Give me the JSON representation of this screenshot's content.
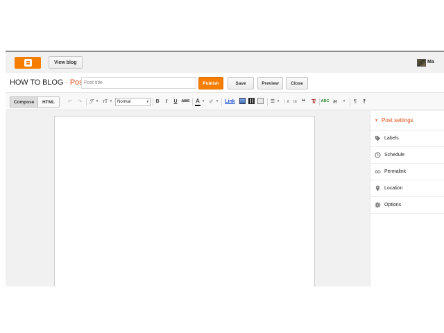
{
  "topbar": {
    "logo_icon": "blogger-icon",
    "view_blog_label": "View blog",
    "account_name": "Ma"
  },
  "titlebar": {
    "blog_name": "HOW TO BLOG",
    "separator": "·",
    "kind": "Post",
    "post_title_placeholder": "Post title",
    "publish_label": "Publish",
    "save_label": "Save",
    "preview_label": "Preview",
    "close_label": "Close"
  },
  "toolbar": {
    "compose_label": "Compose",
    "html_label": "HTML",
    "undo_glyph": "↶",
    "redo_glyph": "↷",
    "font_glyph": "ℱ",
    "font_size_glyph": "тT",
    "format_value": "Normal",
    "bold_glyph": "B",
    "italic_glyph": "I",
    "underline_glyph": "U",
    "strike_glyph": "ABC",
    "text_color_glyph": "A",
    "highlight_glyph": "✐",
    "link_label": "Link",
    "align_glyph": "☰",
    "numbered_glyph": "⋮≡",
    "bullets_glyph": "⁝≡",
    "quote_glyph": "❝",
    "clear_glyph": "T̸",
    "spell_glyph": "ABC",
    "translit_glyph": "अ",
    "ltr_glyph": "¶",
    "rtl_glyph": "¶",
    "caret_glyph": "▾"
  },
  "settings": {
    "header": "Post settings",
    "header_glyph": "▼",
    "items": [
      {
        "label": "Labels",
        "icon": "tag-icon"
      },
      {
        "label": "Schedule",
        "icon": "clock-icon"
      },
      {
        "label": "Permalink",
        "icon": "link-icon"
      },
      {
        "label": "Location",
        "icon": "pin-icon"
      },
      {
        "label": "Options",
        "icon": "gear-icon"
      }
    ]
  },
  "colors": {
    "accent": "#f57d00",
    "title_accent": "#dd4b10",
    "link": "#1a4fd6"
  }
}
